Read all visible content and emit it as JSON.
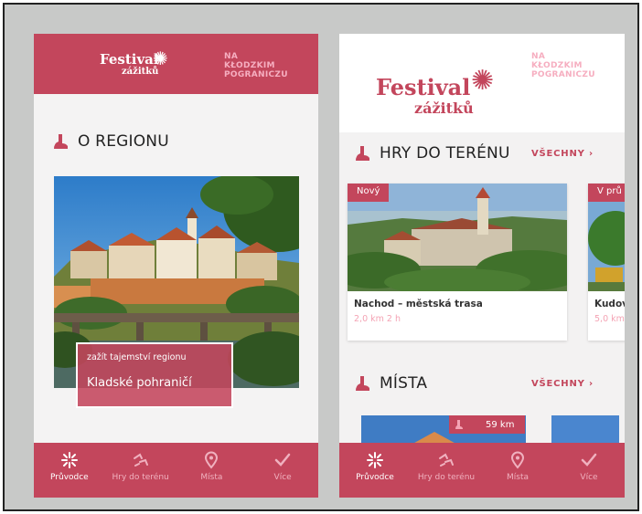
{
  "left_screen": {
    "header": {
      "logo_word1": "Festival",
      "logo_word2": "zážitků",
      "subtitle_lines": [
        "NA",
        "KŁODZKIM",
        "POGRANICZU"
      ]
    },
    "section_title": "O REGIONU",
    "feature": {
      "kicker": "zažít tajemství regionu",
      "title": "Kladské pohraničí"
    }
  },
  "right_screen": {
    "header": {
      "logo_word1": "Festival",
      "logo_word2": "zážitků",
      "subtitle_lines": [
        "NA",
        "KŁODZKIM",
        "POGRANICZU"
      ]
    },
    "games_section": {
      "title": "HRY DO TERÉNU",
      "see_all": "VŠECHNY ›",
      "cards": [
        {
          "tag": "Nový",
          "title": "Nachod – městská trasa",
          "meta": "2,0 km  2 h"
        },
        {
          "tag": "V prů",
          "title": "Kudov",
          "meta": "5,0 km"
        }
      ]
    },
    "places_section": {
      "title": "MÍSTA",
      "see_all": "VŠECHNY ›",
      "distance_badge": "59 km"
    }
  },
  "bottom_nav": {
    "items": [
      {
        "label": "Průvodce",
        "icon": "guide-star-icon",
        "active": true
      },
      {
        "label": "Hry do terénu",
        "icon": "games-icon",
        "active": false
      },
      {
        "label": "Místa",
        "icon": "map-pin-icon",
        "active": false
      },
      {
        "label": "Více",
        "icon": "checkmark-icon",
        "active": false
      }
    ]
  },
  "colors": {
    "brand": "#c3465c",
    "brand_light": "#f4a3b4",
    "frame": "#c8c9c8"
  }
}
